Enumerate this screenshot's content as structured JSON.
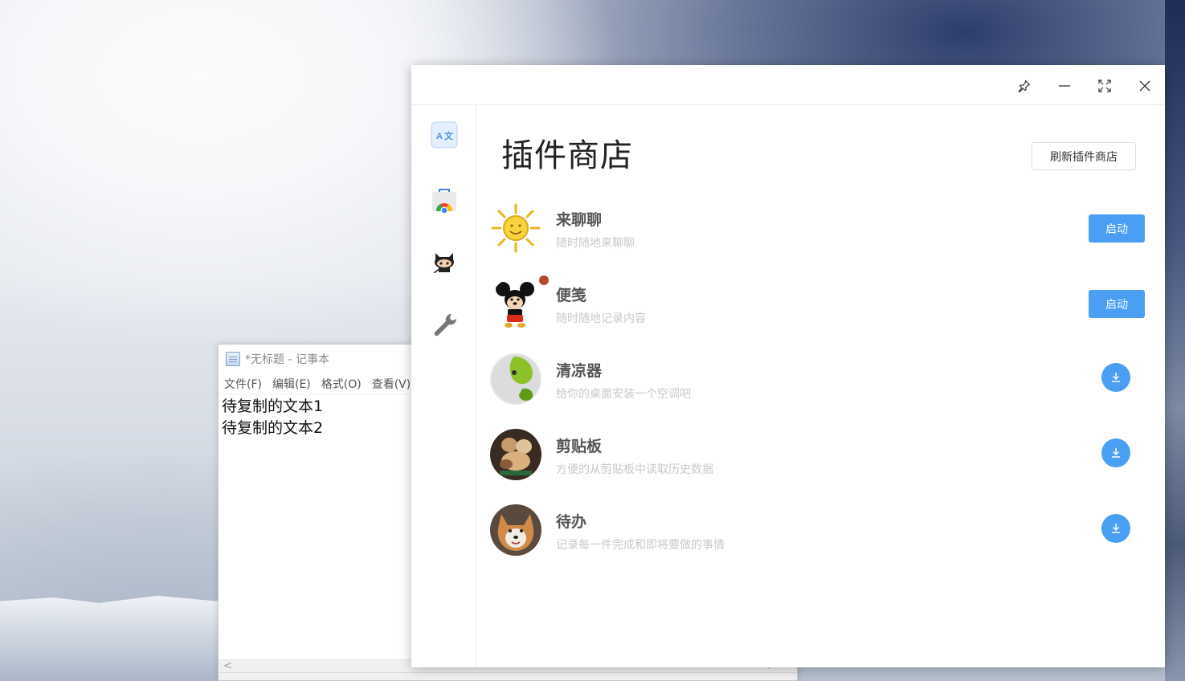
{
  "notepad": {
    "title": "*无标题 - 记事本",
    "menu": [
      "文件(F)",
      "编辑(E)",
      "格式(O)",
      "查看(V)"
    ],
    "lines": [
      "待复制的文本1",
      "待复制的文本2"
    ],
    "scroll_left": "<",
    "scroll_right": ">"
  },
  "app": {
    "window_controls": [
      "pin-icon",
      "minimize-icon",
      "maximize-icon",
      "close-icon"
    ],
    "sidebar_icons": [
      "translate-icon",
      "store-icon",
      "github-icon",
      "wrench-icon"
    ],
    "page_title": "插件商店",
    "refresh_label": "刷新插件商店",
    "plugins": [
      {
        "name": "来聊聊",
        "desc": "随时随地来聊聊",
        "action": "启动",
        "icon": "sun-avatar"
      },
      {
        "name": "便笺",
        "desc": "随时随地记录内容",
        "action": "启动",
        "icon": "mouse-avatar"
      },
      {
        "name": "清凉器",
        "desc": "给你的桌面安装一个空调吧",
        "action": "download-icon",
        "icon": "fan-avatar"
      },
      {
        "name": "剪贴板",
        "desc": "方便的从剪贴板中读取历史数据",
        "action": "download-icon",
        "icon": "cat-avatar"
      },
      {
        "name": "待办",
        "desc": "记录每一件完成和即将要做的事情",
        "action": "download-icon",
        "icon": "dog-avatar"
      }
    ],
    "colors": {
      "accent": "#4a9ff5",
      "badge": "#b5472a"
    }
  }
}
